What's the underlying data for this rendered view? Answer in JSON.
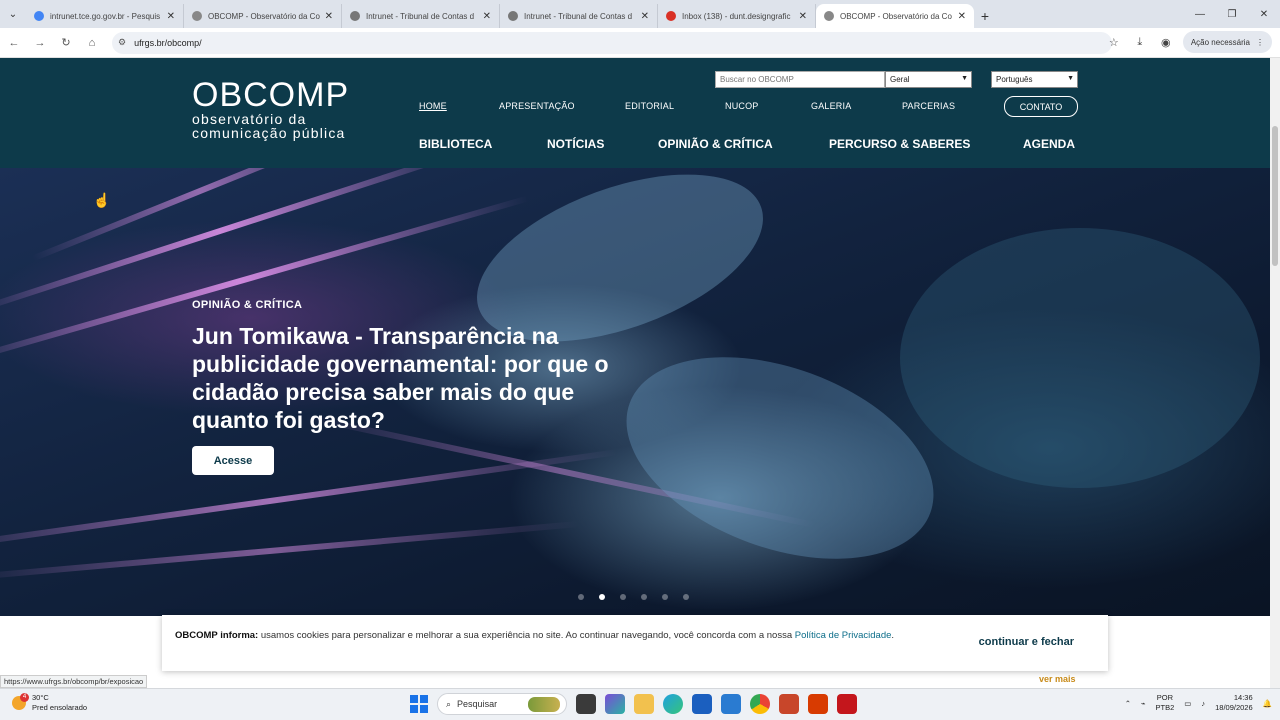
{
  "browser": {
    "tabs": [
      {
        "title": "intrunet.tce.go.gov.br - Pesquis",
        "favicon_color": "#4285f4",
        "active": false
      },
      {
        "title": "OBCOMP - Observatório da Co",
        "favicon_color": "#888888",
        "active": false
      },
      {
        "title": "Intrunet - Tribunal de Contas d",
        "favicon_color": "#777777",
        "active": false
      },
      {
        "title": "Intrunet - Tribunal de Contas d",
        "favicon_color": "#777777",
        "active": false
      },
      {
        "title": "Inbox (138) - dunt.designgrafic",
        "favicon_color": "#d93025",
        "active": false
      },
      {
        "title": "OBCOMP - Observatório da Co",
        "favicon_color": "#888888",
        "active": true
      }
    ],
    "url": "ufrgs.br/obcomp/",
    "action_button": "Ação necessária",
    "status_url": "https://www.ufrgs.br/obcomp/br/exposicao"
  },
  "site": {
    "logo": {
      "main": "OBCOMP",
      "line1": "observatório da",
      "line2": "comunicação pública"
    },
    "search_placeholder": "Buscar no OBCOMP",
    "search_scope": "Geral",
    "language": "Português",
    "menu_top": [
      "HOME",
      "APRESENTAÇÃO",
      "EDITORIAL",
      "NUCOP",
      "GALERIA",
      "PARCERIAS"
    ],
    "contact_label": "CONTATO",
    "menu_main": [
      "BIBLIOTECA",
      "NOTÍCIAS",
      "OPINIÃO & CRÍTICA",
      "PERCURSO & SABERES",
      "AGENDA"
    ],
    "brand_color": "#0d3a4a"
  },
  "hero": {
    "category": "OPINIÃO & CRÍTICA",
    "title": "Jun Tomikawa - Transparência na publicidade governamental: por que o cidadão precisa saber mais do que quanto foi gasto?",
    "button": "Acesse",
    "slides_total": 6,
    "slide_active": 2
  },
  "cookie": {
    "lead": "OBCOMP informa:",
    "text": " usamos cookies para personalizar e melhorar a sua experiência no site. Ao continuar navegando, você concorda com a nossa ",
    "link": "Política de Privacidade",
    "end": ".",
    "close": "continuar e fechar"
  },
  "ver_mais": "ver mais",
  "taskbar": {
    "temp": "30°C",
    "weather": "Pred ensolarado",
    "weather_badge": "4",
    "search": "Pesquisar",
    "lang1": "POR",
    "lang2": "PTB2",
    "time": "14:36",
    "date": "18/09/2026"
  }
}
